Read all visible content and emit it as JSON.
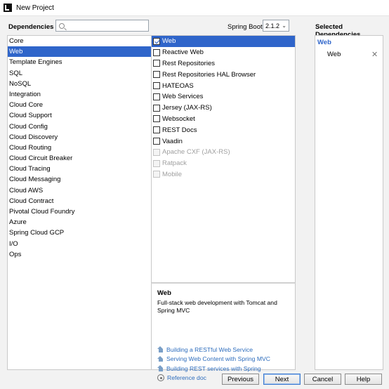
{
  "window": {
    "title": "New Project"
  },
  "header": {
    "dependencies_label": "Dependencies",
    "search_placeholder": "",
    "spring_boot_label": "Spring Boot",
    "spring_boot_version": "2.1.2",
    "selected_label": "Selected Dependencies"
  },
  "categories": [
    {
      "label": "Core",
      "selected": false
    },
    {
      "label": "Web",
      "selected": true
    },
    {
      "label": "Template Engines",
      "selected": false
    },
    {
      "label": "SQL",
      "selected": false
    },
    {
      "label": "NoSQL",
      "selected": false
    },
    {
      "label": "Integration",
      "selected": false
    },
    {
      "label": "Cloud Core",
      "selected": false
    },
    {
      "label": "Cloud Support",
      "selected": false
    },
    {
      "label": "Cloud Config",
      "selected": false
    },
    {
      "label": "Cloud Discovery",
      "selected": false
    },
    {
      "label": "Cloud Routing",
      "selected": false
    },
    {
      "label": "Cloud Circuit Breaker",
      "selected": false
    },
    {
      "label": "Cloud Tracing",
      "selected": false
    },
    {
      "label": "Cloud Messaging",
      "selected": false
    },
    {
      "label": "Cloud AWS",
      "selected": false
    },
    {
      "label": "Cloud Contract",
      "selected": false
    },
    {
      "label": "Pivotal Cloud Foundry",
      "selected": false
    },
    {
      "label": "Azure",
      "selected": false
    },
    {
      "label": "Spring Cloud GCP",
      "selected": false
    },
    {
      "label": "I/O",
      "selected": false
    },
    {
      "label": "Ops",
      "selected": false
    }
  ],
  "dependencies": [
    {
      "label": "Web",
      "checked": true,
      "selected": true,
      "disabled": false
    },
    {
      "label": "Reactive Web",
      "checked": false,
      "selected": false,
      "disabled": false
    },
    {
      "label": "Rest Repositories",
      "checked": false,
      "selected": false,
      "disabled": false
    },
    {
      "label": "Rest Repositories HAL Browser",
      "checked": false,
      "selected": false,
      "disabled": false
    },
    {
      "label": "HATEOAS",
      "checked": false,
      "selected": false,
      "disabled": false
    },
    {
      "label": "Web Services",
      "checked": false,
      "selected": false,
      "disabled": false
    },
    {
      "label": "Jersey (JAX-RS)",
      "checked": false,
      "selected": false,
      "disabled": false
    },
    {
      "label": "Websocket",
      "checked": false,
      "selected": false,
      "disabled": false
    },
    {
      "label": "REST Docs",
      "checked": false,
      "selected": false,
      "disabled": false
    },
    {
      "label": "Vaadin",
      "checked": false,
      "selected": false,
      "disabled": false
    },
    {
      "label": "Apache CXF (JAX-RS)",
      "checked": false,
      "selected": false,
      "disabled": true
    },
    {
      "label": "Ratpack",
      "checked": false,
      "selected": false,
      "disabled": true
    },
    {
      "label": "Mobile",
      "checked": false,
      "selected": false,
      "disabled": true
    }
  ],
  "description": {
    "title": "Web",
    "text": "Full-stack web development with Tomcat and Spring MVC",
    "links": [
      {
        "label": "Building a RESTful Web Service",
        "icon": "home-icon"
      },
      {
        "label": "Serving Web Content with Spring MVC",
        "icon": "home-icon"
      },
      {
        "label": "Building REST services with Spring",
        "icon": "home-icon"
      },
      {
        "label": "Reference doc",
        "icon": "doc-icon"
      }
    ]
  },
  "selected_dependencies": {
    "group": "Web",
    "items": [
      "Web"
    ]
  },
  "buttons": {
    "previous": "Previous",
    "next": "Next",
    "cancel": "Cancel",
    "help": "Help"
  },
  "colors": {
    "selection": "#2f65ca",
    "link": "#2e6dbd"
  }
}
